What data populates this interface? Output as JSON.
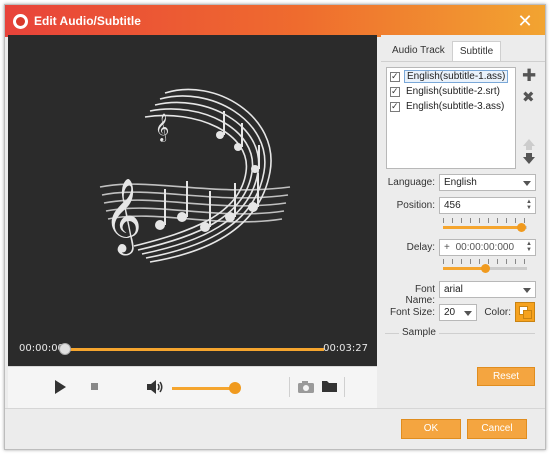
{
  "window": {
    "title": "Edit Audio/Subtitle"
  },
  "player": {
    "current_time": "00:00:00",
    "total_time": "00:03:27",
    "seek_progress": 0,
    "volume_level": 0.9
  },
  "tabs": [
    {
      "label": "Audio Track",
      "active": false
    },
    {
      "label": "Subtitle",
      "active": true
    }
  ],
  "subtitles": [
    {
      "label": "English(subtitle-1.ass)",
      "checked": true,
      "selected": true
    },
    {
      "label": "English(subtitle-2.srt)",
      "checked": true,
      "selected": false
    },
    {
      "label": "English(subtitle-3.ass)",
      "checked": true,
      "selected": false
    }
  ],
  "settings": {
    "language_label": "Language:",
    "language_value": "English",
    "position_label": "Position:",
    "position_value": "456",
    "position_level": 0.93,
    "delay_label": "Delay:",
    "delay_sign": "+",
    "delay_value": "00:00:00:000",
    "delay_level": 0.5,
    "font_name_label": "Font Name:",
    "font_name_value": "arial",
    "font_size_label": "Font Size:",
    "font_size_value": "20",
    "color_label": "Color:",
    "sample_label": "Sample"
  },
  "buttons": {
    "reset": "Reset",
    "ok": "OK",
    "cancel": "Cancel"
  },
  "colors": {
    "accent": "#f4a540",
    "title_gradient_start": "#e8433a",
    "title_gradient_end": "#f2a431",
    "font_color": "#f6a21e"
  }
}
